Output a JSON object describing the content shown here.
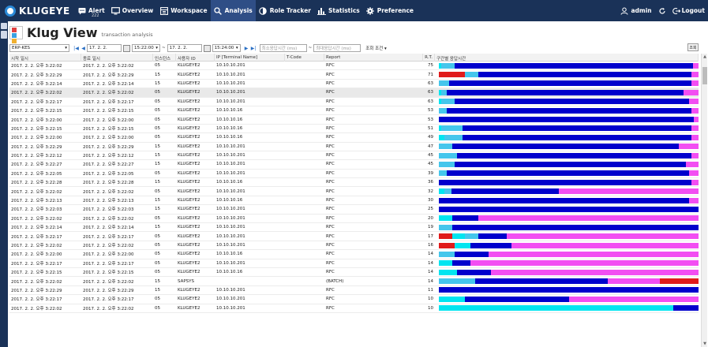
{
  "app": {
    "logo_text": "KLUGEYE"
  },
  "nav": [
    {
      "label": "Alert",
      "icon": "message-icon",
      "badge": "222"
    },
    {
      "label": "Overview",
      "icon": "monitor-icon"
    },
    {
      "label": "Workspace",
      "icon": "workspace-icon"
    },
    {
      "label": "Analysis",
      "icon": "search-icon",
      "active": true
    },
    {
      "label": "Role Tracker",
      "icon": "shield-icon"
    },
    {
      "label": "Statistics",
      "icon": "bar-chart-icon"
    },
    {
      "label": "Preference",
      "icon": "gear-icon"
    }
  ],
  "user": {
    "name": "admin",
    "logout": "Logout"
  },
  "page": {
    "title": "Klug View",
    "subtitle": "transaction analysis"
  },
  "toolbar": {
    "system": "ERP-KES",
    "date_from": "17. 2. 2.",
    "time_from": "15:22:00",
    "tilde": "~",
    "date_to": "17. 2. 2.",
    "time_to": "15:24:00",
    "min_placeholder": "최소응답시간 (ms)",
    "max_placeholder": "최대응답시간 (ms)",
    "condition": "조회 조건 ▾",
    "search_label": "조회"
  },
  "columns": [
    "시작 일시",
    "종료 일시",
    "인스턴스",
    "사용자 ID",
    "IP [Terminal Name]",
    "T-Code",
    "Report",
    "R.T.",
    "구간별 응답시간"
  ],
  "colors": {
    "lightcyan": "#45c6ec",
    "cyan": "#00e5f0",
    "blue": "#0000cc",
    "magenta": "#f24ef2",
    "red": "#e01b1b"
  },
  "rows": [
    {
      "start": "2017. 2. 2. 오후 3:22:02",
      "end": "2017. 2. 2. 오후 3:22:02",
      "inst": "05",
      "user": "KLUGEYE2",
      "ip": "10.10.10.201",
      "tcode": "",
      "report": "RFC",
      "rt": "75",
      "segs": [
        [
          "cyan",
          0.01
        ],
        [
          "lightcyan",
          0.05
        ],
        [
          "blue",
          0.915
        ],
        [
          "magenta",
          0.025
        ]
      ]
    },
    {
      "start": "2017. 2. 2. 오후 3:22:29",
      "end": "2017. 2. 2. 오후 3:22:29",
      "inst": "15",
      "user": "KLUGEYE2",
      "ip": "10.10.10.201",
      "tcode": "",
      "report": "RFC",
      "rt": "71",
      "segs": [
        [
          "red",
          0.1
        ],
        [
          "lightcyan",
          0.05
        ],
        [
          "blue",
          0.82
        ],
        [
          "magenta",
          0.03
        ]
      ]
    },
    {
      "start": "2017. 2. 2. 오후 3:22:14",
      "end": "2017. 2. 2. 오후 3:22:14",
      "inst": "15",
      "user": "KLUGEYE2",
      "ip": "10.10.10.201",
      "tcode": "",
      "report": "RFC",
      "rt": "63",
      "segs": [
        [
          "lightcyan",
          0.04
        ],
        [
          "blue",
          0.93
        ],
        [
          "magenta",
          0.03
        ]
      ]
    },
    {
      "start": "2017. 2. 2. 오후 3:22:02",
      "end": "2017. 2. 2. 오후 3:22:02",
      "inst": "05",
      "user": "KLUGEYE2",
      "ip": "10.10.10.201",
      "tcode": "",
      "report": "RFC",
      "rt": "63",
      "segs": [
        [
          "cyan",
          0.01
        ],
        [
          "lightcyan",
          0.02
        ],
        [
          "blue",
          0.91
        ],
        [
          "magenta",
          0.06
        ]
      ],
      "sel": true
    },
    {
      "start": "2017. 2. 2. 오후 3:22:17",
      "end": "2017. 2. 2. 오후 3:22:17",
      "inst": "05",
      "user": "KLUGEYE2",
      "ip": "10.10.10.201",
      "tcode": "",
      "report": "RFC",
      "rt": "63",
      "segs": [
        [
          "cyan",
          0.01
        ],
        [
          "lightcyan",
          0.05
        ],
        [
          "blue",
          0.9
        ],
        [
          "magenta",
          0.04
        ]
      ]
    },
    {
      "start": "2017. 2. 2. 오후 3:22:15",
      "end": "2017. 2. 2. 오후 3:22:15",
      "inst": "05",
      "user": "KLUGEYE2",
      "ip": "10.10.10.16",
      "tcode": "",
      "report": "RFC",
      "rt": "53",
      "segs": [
        [
          "lightcyan",
          0.03
        ],
        [
          "blue",
          0.94
        ],
        [
          "magenta",
          0.03
        ]
      ]
    },
    {
      "start": "2017. 2. 2. 오후 3:22:00",
      "end": "2017. 2. 2. 오후 3:22:00",
      "inst": "05",
      "user": "KLUGEYE2",
      "ip": "10.10.10.16",
      "tcode": "",
      "report": "RFC",
      "rt": "53",
      "segs": [
        [
          "blue",
          0.98
        ],
        [
          "magenta",
          0.02
        ]
      ]
    },
    {
      "start": "2017. 2. 2. 오후 3:22:15",
      "end": "2017. 2. 2. 오후 3:22:15",
      "inst": "05",
      "user": "KLUGEYE2",
      "ip": "10.10.10.16",
      "tcode": "",
      "report": "RFC",
      "rt": "51",
      "segs": [
        [
          "cyan",
          0.01
        ],
        [
          "lightcyan",
          0.08
        ],
        [
          "blue",
          0.88
        ],
        [
          "magenta",
          0.03
        ]
      ]
    },
    {
      "start": "2017. 2. 2. 오후 3:22:00",
      "end": "2017. 2. 2. 오후 3:22:00",
      "inst": "05",
      "user": "KLUGEYE2",
      "ip": "10.10.10.16",
      "tcode": "",
      "report": "RFC",
      "rt": "49",
      "segs": [
        [
          "cyan",
          0.02
        ],
        [
          "lightcyan",
          0.07
        ],
        [
          "blue",
          0.88
        ],
        [
          "magenta",
          0.03
        ]
      ]
    },
    {
      "start": "2017. 2. 2. 오후 3:22:29",
      "end": "2017. 2. 2. 오후 3:22:29",
      "inst": "15",
      "user": "KLUGEYE2",
      "ip": "10.10.10.201",
      "tcode": "",
      "report": "RFC",
      "rt": "47",
      "segs": [
        [
          "lightcyan",
          0.05
        ],
        [
          "blue",
          0.87
        ],
        [
          "magenta",
          0.08
        ]
      ]
    },
    {
      "start": "2017. 2. 2. 오후 3:22:12",
      "end": "2017. 2. 2. 오후 3:22:12",
      "inst": "15",
      "user": "KLUGEYE2",
      "ip": "10.10.10.201",
      "tcode": "",
      "report": "RFC",
      "rt": "45",
      "segs": [
        [
          "lightcyan",
          0.07
        ],
        [
          "blue",
          0.9
        ],
        [
          "magenta",
          0.03
        ]
      ]
    },
    {
      "start": "2017. 2. 2. 오후 3:22:27",
      "end": "2017. 2. 2. 오후 3:22:27",
      "inst": "15",
      "user": "KLUGEYE2",
      "ip": "10.10.10.201",
      "tcode": "",
      "report": "RFC",
      "rt": "45",
      "segs": [
        [
          "lightcyan",
          0.06
        ],
        [
          "blue",
          0.89
        ],
        [
          "magenta",
          0.05
        ]
      ]
    },
    {
      "start": "2017. 2. 2. 오후 3:22:05",
      "end": "2017. 2. 2. 오후 3:22:05",
      "inst": "05",
      "user": "KLUGEYE2",
      "ip": "10.10.10.201",
      "tcode": "",
      "report": "RFC",
      "rt": "39",
      "segs": [
        [
          "lightcyan",
          0.03
        ],
        [
          "blue",
          0.93
        ],
        [
          "magenta",
          0.04
        ]
      ]
    },
    {
      "start": "2017. 2. 2. 오후 3:22:28",
      "end": "2017. 2. 2. 오후 3:22:28",
      "inst": "15",
      "user": "KLUGEYE2",
      "ip": "10.10.10.16",
      "tcode": "",
      "report": "RFC",
      "rt": "36",
      "segs": [
        [
          "blue",
          0.97
        ],
        [
          "magenta",
          0.03
        ]
      ]
    },
    {
      "start": "2017. 2. 2. 오후 3:22:02",
      "end": "2017. 2. 2. 오후 3:22:02",
      "inst": "05",
      "user": "KLUGEYE2",
      "ip": "10.10.10.201",
      "tcode": "",
      "report": "RFC",
      "rt": "32",
      "segs": [
        [
          "cyan",
          0.02
        ],
        [
          "lightcyan",
          0.03
        ],
        [
          "blue",
          0.41
        ],
        [
          "magenta",
          0.54
        ]
      ]
    },
    {
      "start": "2017. 2. 2. 오후 3:22:13",
      "end": "2017. 2. 2. 오후 3:22:13",
      "inst": "15",
      "user": "KLUGEYE2",
      "ip": "10.10.10.16",
      "tcode": "",
      "report": "RFC",
      "rt": "30",
      "segs": [
        [
          "blue",
          0.96
        ],
        [
          "magenta",
          0.04
        ]
      ]
    },
    {
      "start": "2017. 2. 2. 오후 3:22:03",
      "end": "2017. 2. 2. 오후 3:22:03",
      "inst": "15",
      "user": "KLUGEYE2",
      "ip": "10.10.10.201",
      "tcode": "",
      "report": "RFC",
      "rt": "25",
      "segs": [
        [
          "blue",
          1.0
        ]
      ]
    },
    {
      "start": "2017. 2. 2. 오후 3:22:02",
      "end": "2017. 2. 2. 오후 3:22:02",
      "inst": "05",
      "user": "KLUGEYE2",
      "ip": "10.10.10.201",
      "tcode": "",
      "report": "RFC",
      "rt": "20",
      "segs": [
        [
          "cyan",
          0.05
        ],
        [
          "blue",
          0.1
        ],
        [
          "magenta",
          0.85
        ]
      ]
    },
    {
      "start": "2017. 2. 2. 오후 3:22:14",
      "end": "2017. 2. 2. 오후 3:22:14",
      "inst": "15",
      "user": "KLUGEYE2",
      "ip": "10.10.10.201",
      "tcode": "",
      "report": "RFC",
      "rt": "19",
      "segs": [
        [
          "lightcyan",
          0.05
        ],
        [
          "blue",
          0.95
        ]
      ]
    },
    {
      "start": "2017. 2. 2. 오후 3:22:17",
      "end": "2017. 2. 2. 오후 3:22:17",
      "inst": "05",
      "user": "KLUGEYE2",
      "ip": "10.10.10.201",
      "tcode": "",
      "report": "RFC",
      "rt": "17",
      "segs": [
        [
          "red",
          0.05
        ],
        [
          "cyan",
          0.05
        ],
        [
          "lightcyan",
          0.05
        ],
        [
          "blue",
          0.11
        ],
        [
          "magenta",
          0.74
        ]
      ]
    },
    {
      "start": "2017. 2. 2. 오후 3:22:02",
      "end": "2017. 2. 2. 오후 3:22:02",
      "inst": "05",
      "user": "KLUGEYE2",
      "ip": "10.10.10.201",
      "tcode": "",
      "report": "RFC",
      "rt": "16",
      "segs": [
        [
          "red",
          0.06
        ],
        [
          "cyan",
          0.06
        ],
        [
          "blue",
          0.16
        ],
        [
          "magenta",
          0.72
        ]
      ]
    },
    {
      "start": "2017. 2. 2. 오후 3:22:00",
      "end": "2017. 2. 2. 오후 3:22:00",
      "inst": "05",
      "user": "KLUGEYE2",
      "ip": "10.10.10.16",
      "tcode": "",
      "report": "RFC",
      "rt": "14",
      "segs": [
        [
          "lightcyan",
          0.06
        ],
        [
          "blue",
          0.13
        ],
        [
          "magenta",
          0.81
        ]
      ]
    },
    {
      "start": "2017. 2. 2. 오후 3:22:17",
      "end": "2017. 2. 2. 오후 3:22:17",
      "inst": "05",
      "user": "KLUGEYE2",
      "ip": "10.10.10.201",
      "tcode": "",
      "report": "RFC",
      "rt": "14",
      "segs": [
        [
          "cyan",
          0.05
        ],
        [
          "blue",
          0.07
        ],
        [
          "magenta",
          0.88
        ]
      ]
    },
    {
      "start": "2017. 2. 2. 오후 3:22:15",
      "end": "2017. 2. 2. 오후 3:22:15",
      "inst": "05",
      "user": "KLUGEYE2",
      "ip": "10.10.10.16",
      "tcode": "",
      "report": "RFC",
      "rt": "14",
      "segs": [
        [
          "cyan",
          0.07
        ],
        [
          "blue",
          0.13
        ],
        [
          "magenta",
          0.8
        ]
      ]
    },
    {
      "start": "2017. 2. 2. 오후 3:22:02",
      "end": "2017. 2. 2. 오후 3:22:02",
      "inst": "15",
      "user": "SAPSYS",
      "ip": "",
      "tcode": "",
      "report": "(BATCH)",
      "rt": "14",
      "segs": [
        [
          "lightcyan",
          0.14
        ],
        [
          "blue",
          0.51
        ],
        [
          "magenta",
          0.2
        ],
        [
          "red",
          0.15
        ]
      ]
    },
    {
      "start": "2017. 2. 2. 오후 3:22:29",
      "end": "2017. 2. 2. 오후 3:22:29",
      "inst": "15",
      "user": "KLUGEYE2",
      "ip": "10.10.10.201",
      "tcode": "",
      "report": "RFC",
      "rt": "11",
      "segs": [
        [
          "blue",
          1.0
        ]
      ]
    },
    {
      "start": "2017. 2. 2. 오후 3:22:17",
      "end": "2017. 2. 2. 오후 3:22:17",
      "inst": "05",
      "user": "KLUGEYE2",
      "ip": "10.10.10.201",
      "tcode": "",
      "report": "RFC",
      "rt": "10",
      "segs": [
        [
          "cyan",
          0.1
        ],
        [
          "blue",
          0.4
        ],
        [
          "magenta",
          0.5
        ]
      ]
    },
    {
      "start": "2017. 2. 2. 오후 3:22:02",
      "end": "2017. 2. 2. 오후 3:22:02",
      "inst": "05",
      "user": "KLUGEYE2",
      "ip": "10.10.10.201",
      "tcode": "",
      "report": "RFC",
      "rt": "10",
      "segs": [
        [
          "cyan",
          0.9
        ],
        [
          "blue",
          0.1
        ]
      ]
    }
  ]
}
